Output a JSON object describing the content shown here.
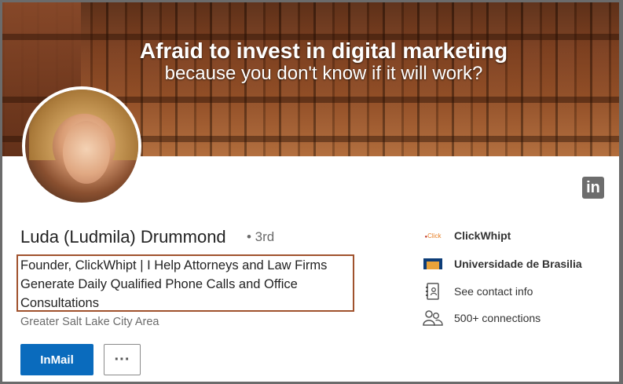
{
  "banner": {
    "headline_line1": "Afraid to invest in digital marketing",
    "headline_line2": "because you don't know if it will work?"
  },
  "profile": {
    "name": "Luda (Ludmila) Drummond",
    "degree": "• 3rd",
    "headline": "Founder, ClickWhipt | I Help Attorneys and Law Firms Generate Daily Qualified Phone Calls and Office Consultations",
    "location": "Greater Salt Lake City Area"
  },
  "actions": {
    "inmail_label": "InMail",
    "more_label": "···"
  },
  "sidebar": {
    "items": [
      {
        "label": "ClickWhipt",
        "icon": "company-logo-icon"
      },
      {
        "label": "Universidade de Brasilia",
        "icon": "school-logo-icon"
      },
      {
        "label": "See contact info",
        "icon": "contact-card-icon"
      },
      {
        "label": "500+ connections",
        "icon": "people-icon"
      }
    ]
  },
  "social": {
    "linkedin_icon_text": "in"
  },
  "colors": {
    "inmail_bg": "#0a6bbd",
    "highlight_border": "#a0522d"
  }
}
